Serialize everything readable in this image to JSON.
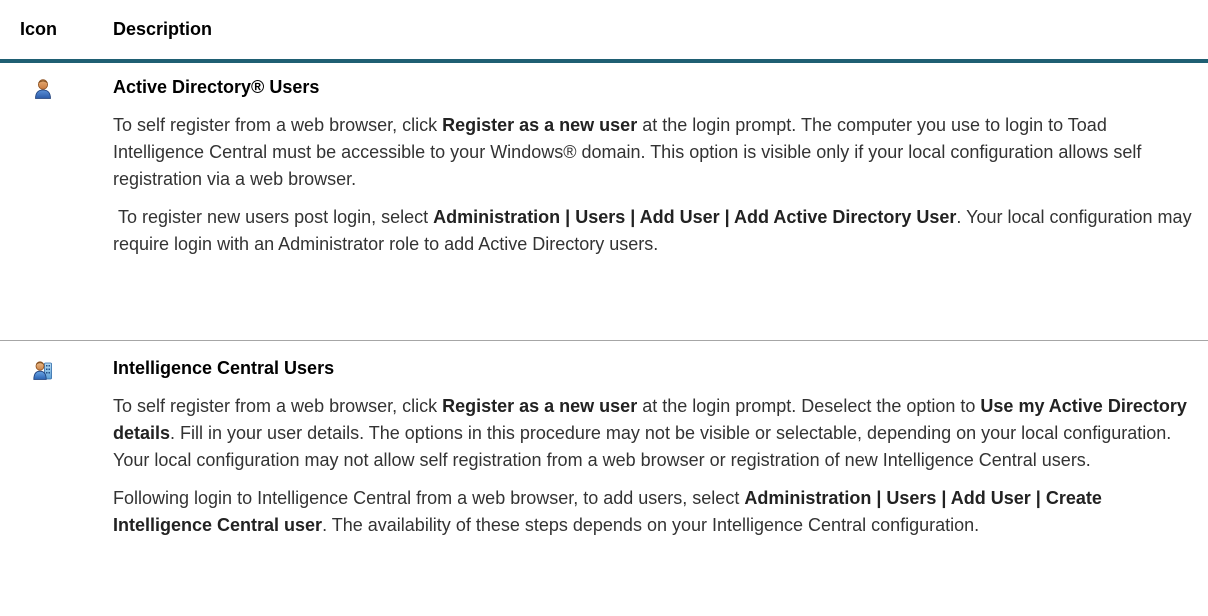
{
  "header": {
    "icon_col": "Icon",
    "desc_col": "Description"
  },
  "rows": [
    {
      "icon": "ad-user-icon",
      "title": "Active Directory® Users",
      "p1": {
        "t1": "To self register from a web browser, click ",
        "b1": "Register as a new user",
        "t2": " at the login prompt. The computer you use to login to Toad Intelligence Central must be accessible to your Windows® domain. This option is visible only if your local configuration allows self registration via a web browser."
      },
      "p2": {
        "t1": " To register new users post login, select ",
        "b1": "Administration | Users | Add User | Add Active Directory User",
        "t2": ". Your local configuration may require login with an Administrator role to add Active Directory users."
      }
    },
    {
      "icon": "ic-user-icon",
      "title": "Intelligence Central Users",
      "p1": {
        "t1": "To self register from a web browser, click ",
        "b1": "Register as a new user",
        "t2": " at the login prompt. Deselect the option to ",
        "b2": "Use my Active Directory details",
        "t3": ". Fill in your user details. The options in this procedure may not be visible or selectable, depending on your local configuration. Your local configuration may not allow self registration from a web browser or registration of new Intelligence Central users."
      },
      "p2": {
        "t1": "Following login to Intelligence Central from a web browser, to add users, select ",
        "b1": "Administration | Users | Add User | Create Intelligence Central user",
        "t2": ". The availability of these steps depends on your Intelligence Central configuration."
      }
    }
  ]
}
